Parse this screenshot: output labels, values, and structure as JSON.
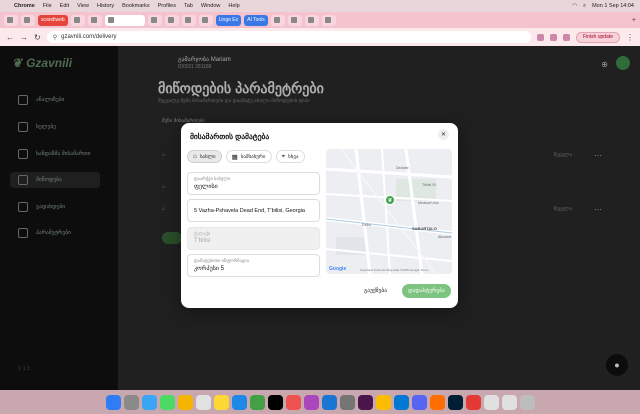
{
  "menubar": {
    "app": "Chrome",
    "items": [
      "File",
      "Edit",
      "View",
      "History",
      "Bookmarks",
      "Profiles",
      "Tab",
      "Window",
      "Help"
    ],
    "clock": "Mon 1 Sep  14:04"
  },
  "tabs": {
    "badge_tab": "scandiweb",
    "tab_dp": "Lingo Ex",
    "tab_ai": "AI Tools",
    "active_tab": ""
  },
  "address": {
    "url": "gzavnili.com/delivery",
    "finish_update": "Finish update"
  },
  "sidebar": {
    "logo": "Gzavnili",
    "items": [
      {
        "label": "ანალიზები"
      },
      {
        "label": "ხელებე"
      },
      {
        "label": "ხანდაზმა მისამართი"
      },
      {
        "label": "მიწოდება"
      },
      {
        "label": "გადახდები"
      },
      {
        "label": "პარამეტრები"
      }
    ],
    "footer": "V 1.3"
  },
  "main": {
    "user_name": "გამარჯობა Mariam",
    "user_id": "ID0011 281188",
    "title": "მიწოდების პარამეტრები",
    "subtitle": "შეცვალე შენი მისამართები და დაამატე ახალი მიწოდების ტიპი",
    "section": "შენი მისამართები",
    "row_edit": "შეცვლა",
    "chat_icon": "chat-icon"
  },
  "modal": {
    "title": "მისამართის დამატება",
    "tabs": [
      {
        "label": "სახლი",
        "selected": true
      },
      {
        "label": "სამსახური",
        "selected": false
      },
      {
        "label": "სხვა",
        "selected": false
      }
    ],
    "fields": {
      "address_name_label": "დაარქვი სახელი",
      "address_name_value": "ფელისი",
      "street": "5 Vazha-Pshavela Dead End, T'bilisi, Georgia",
      "disabled_label": "ქალაქი",
      "disabled_value": "T'bilisi",
      "extra_label": "დამატებითი ინფორმაცია",
      "extra_value": "კორპუსი 5"
    },
    "map": {
      "labels": {
        "dedube": "Dedube",
        "tbilisi_state": "Tbilisi St.",
        "medical": "Medical Univ.",
        "delisi": "Delisi",
        "saburtalo": "SABURTALO",
        "alexand": "Alexand"
      },
      "google": "Google",
      "footer": "Keyboard shortcuts   Map data ©2025 Google   Terms"
    },
    "cancel": "გაუქმება",
    "save": "დადასტურება"
  },
  "colors": {
    "accent": "#7cc47f",
    "sidebar_bg": "#121212",
    "tab_strip": "#f4c3cd"
  }
}
